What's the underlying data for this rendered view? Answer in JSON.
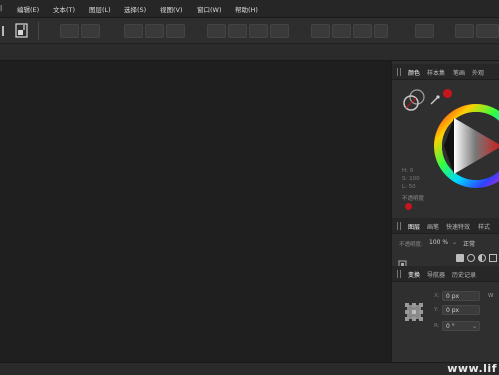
{
  "menu": {
    "items": [
      "编辑(E)",
      "文本(T)",
      "图层(L)",
      "选择(S)",
      "视图(V)",
      "窗口(W)",
      "帮助(H)"
    ]
  },
  "color_panel": {
    "tabs": [
      "颜色",
      "样本集",
      "笔画",
      "外观"
    ],
    "hsl_labels": [
      "H: 0",
      "S: 100",
      "L: 50"
    ],
    "opacity_label": "不透明度",
    "accent": "#c4161c"
  },
  "layers_panel": {
    "tabs": [
      "图层",
      "画笔",
      "快速特效",
      "样式"
    ],
    "opacity_label": "不透明度:",
    "opacity_value": "100 %",
    "blend_mode": "正常"
  },
  "transform_panel": {
    "tabs": [
      "变换",
      "导航器",
      "历史记录"
    ],
    "fields": [
      {
        "label": "X:",
        "value": "0 px"
      },
      {
        "label": "Y:",
        "value": "0 px"
      },
      {
        "label": "R:",
        "value": "0 °"
      }
    ],
    "w_label": "W"
  },
  "watermark": "www.lif"
}
